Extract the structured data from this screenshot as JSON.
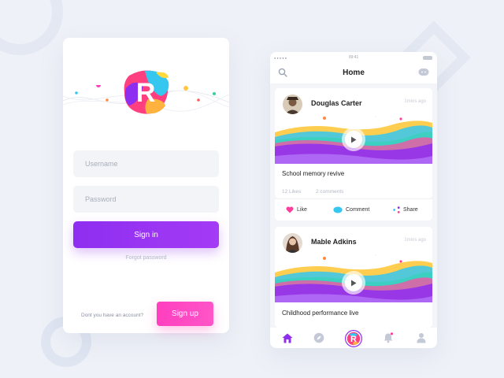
{
  "login": {
    "username_placeholder": "Username",
    "password_placeholder": "Password",
    "signin_label": "Sign in",
    "forgot_label": "Forgot password",
    "no_account_text": "Dont you have an account?",
    "signup_label": "Sign up",
    "logo_letter": "R"
  },
  "phone": {
    "status_time": "09:41",
    "header_title": "Home",
    "posts": [
      {
        "author": "Douglas Carter",
        "time": "1mins ago",
        "caption": "School memory revive",
        "likes": "12 Likes",
        "comments": "2 comments",
        "like_label": "Like",
        "comment_label": "Comment",
        "share_label": "Share"
      },
      {
        "author": "Mable Adkins",
        "time": "1mins ago",
        "caption": "Childhood performance live"
      }
    ],
    "tabs": [
      "home-icon",
      "compass-icon",
      "app-logo-icon",
      "bell-icon",
      "profile-icon"
    ]
  },
  "colors": {
    "primary": "#8e2ef0",
    "pink": "#ff3fbf",
    "like": "#ff3d9a",
    "comment": "#35c7f0"
  }
}
